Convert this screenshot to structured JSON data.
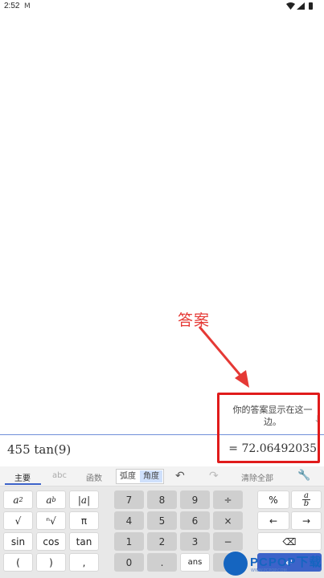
{
  "status_bar": {
    "time": "2:52",
    "sim_icon": "M"
  },
  "annotation": {
    "label": "答案",
    "color": "#e53935"
  },
  "tooltip": {
    "text": "你的答案显示在这一边。"
  },
  "input": {
    "expression": "455 tan(9)",
    "result": "= 72.06492035"
  },
  "keypad": {
    "tabs": {
      "main": "主要",
      "abc": "abc",
      "functions": "函数"
    },
    "angle": {
      "rad": "弧度",
      "deg": "角度"
    },
    "clear_all": "清除全部",
    "row1": [
      "a²",
      "aᵇ",
      "|a|",
      "7",
      "8",
      "9",
      "÷",
      "%",
      "a/b"
    ],
    "row2": [
      "√",
      "ⁿ√",
      "π",
      "4",
      "5",
      "6",
      "×",
      "←",
      "→"
    ],
    "row3": [
      "sin",
      "cos",
      "tan",
      "1",
      "2",
      "3",
      "−",
      "⌫"
    ],
    "row4": [
      "(",
      ")",
      ",",
      "0",
      ".",
      "ans",
      "+",
      "↵"
    ]
  },
  "watermark": {
    "text": "PCPOP下载",
    "sub": "WWW.PCPOP.COM"
  },
  "colors": {
    "accent": "#3c63c9",
    "highlight": "#e01b1b"
  }
}
